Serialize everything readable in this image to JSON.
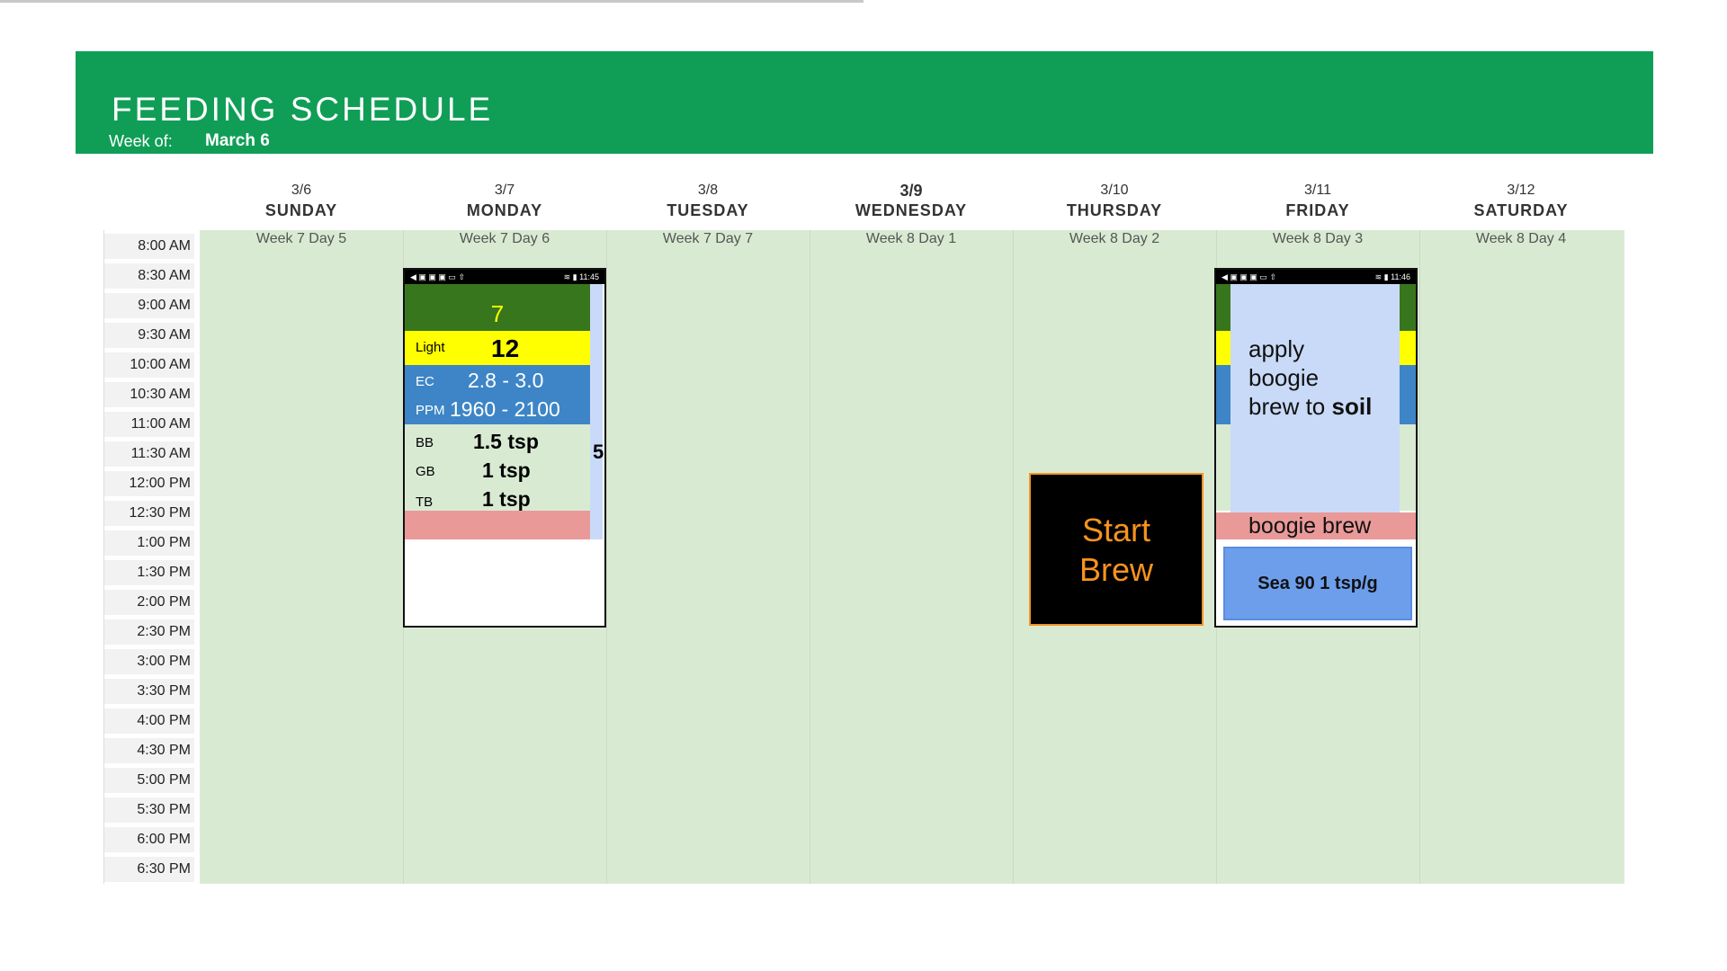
{
  "banner": {
    "title": "FEEDING SCHEDULE",
    "week_label": "Week of:",
    "week_value": "March 6"
  },
  "days": [
    {
      "date": "3/6",
      "name": "SUNDAY",
      "week_day": "Week 7 Day 5"
    },
    {
      "date": "3/7",
      "name": "MONDAY",
      "week_day": "Week 7 Day 6"
    },
    {
      "date": "3/8",
      "name": "TUESDAY",
      "week_day": "Week 7 Day 7"
    },
    {
      "date": "3/9",
      "name": "WEDNESDAY",
      "week_day": "Week 8 Day 1"
    },
    {
      "date": "3/10",
      "name": "THURSDAY",
      "week_day": "Week 8 Day 2"
    },
    {
      "date": "3/11",
      "name": "FRIDAY",
      "week_day": "Week 8 Day 3"
    },
    {
      "date": "3/12",
      "name": "SATURDAY",
      "week_day": "Week 8 Day 4"
    }
  ],
  "times": [
    "8:00 AM",
    "8:30 AM",
    "9:00 AM",
    "9:30 AM",
    "10:00 AM",
    "10:30 AM",
    "11:00 AM",
    "11:30 AM",
    "12:00 PM",
    "12:30 PM",
    "1:00 PM",
    "1:30 PM",
    "2:00 PM",
    "2:30 PM",
    "3:00 PM",
    "3:30 PM",
    "4:00 PM",
    "4:30 PM",
    "5:00 PM",
    "5:30 PM",
    "6:00 PM",
    "6:30 PM"
  ],
  "monday_card": {
    "status_time": "11:45",
    "week_number": "7",
    "light_label": "Light",
    "light_value": "12",
    "ec_label": "EC",
    "ec_value": "2.8 - 3.0",
    "ppm_label": "PPM",
    "ppm_value": "1960 - 2100",
    "bb_label": "BB",
    "bb_value": "1.5 tsp",
    "gb_label": "GB",
    "gb_value": "1 tsp",
    "tb_label": "TB",
    "tb_value": "1 tsp",
    "edge_char": "5"
  },
  "thursday_card": {
    "line1": "Start",
    "line2": "Brew"
  },
  "friday_card": {
    "status_time": "11:46",
    "note_line1": "apply",
    "note_line2": "boogie",
    "note_line3": "brew to ",
    "note_bold": "soil",
    "pink_label": "boogie brew",
    "sea_label": "Sea 90 1 tsp/g"
  },
  "colors": {
    "banner": "#109e57",
    "grid": "#d9ead3",
    "dark_green": "#38761d",
    "yellow": "#ffff00",
    "blue": "#3d85c6",
    "light_blue": "#c9daf8",
    "pink": "#ea9999",
    "brew_orange": "#f7931e"
  }
}
